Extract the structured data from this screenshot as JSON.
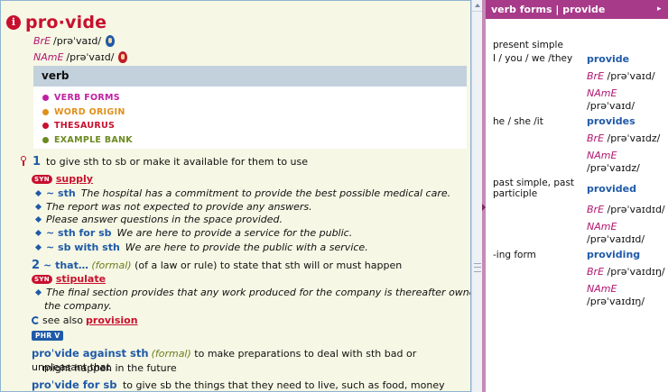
{
  "entry": {
    "headword": "pro·vide",
    "pron_bre_label": "BrE",
    "pron_bre": "/prəˈvaɪd/",
    "pron_name_label": "NAmE",
    "pron_name": "/prəˈvaɪd/",
    "pos": "verb",
    "links": [
      {
        "label": "VERB FORMS",
        "color": "#c020a0"
      },
      {
        "label": "WORD ORIGIN",
        "color": "#e0901a"
      },
      {
        "label": "THESAURUS",
        "color": "#c8102e"
      },
      {
        "label": "EXAMPLE BANK",
        "color": "#6b8a1f"
      }
    ],
    "sense1": {
      "num": "1",
      "definition": "to give sth to sb or make it available for them to use",
      "syn_badge": "SYN",
      "syn": "supply",
      "examples": [
        {
          "pattern": "~ sth",
          "text": "The hospital has a commitment to provide the best possible medical care."
        },
        {
          "pattern": "",
          "text": "The report was not expected to provide any answers."
        },
        {
          "pattern": "",
          "text": "Please answer questions in the space provided."
        },
        {
          "pattern": "~ sth for sb",
          "text": "We are here to provide a service for the public."
        },
        {
          "pattern": "~ sb with sth",
          "text": "We are here to provide the public with a service."
        }
      ]
    },
    "sense2": {
      "num": "2",
      "pattern": "~ that…",
      "register": "(formal)",
      "definition": "(of a law or rule) to state that sth will or must happen",
      "syn_badge": "SYN",
      "syn": "stipulate",
      "example_line1": "The final section provides that any work produced for the company is thereafter owned by",
      "example_line2": "the company.",
      "see_also_label": "see also",
      "see_also_link": "provision"
    },
    "phrv_badge": "PHR V",
    "phrasal": [
      {
        "head": "proˈvide against sth",
        "register": "(formal)",
        "line1": "to make preparations to deal with sth bad or unpleasant that",
        "line2": "might happen in the future"
      },
      {
        "head": "proˈvide for sb",
        "register": "",
        "line1": "to give sb the things that they need to live, such as food, money and clothing",
        "line2": ""
      }
    ]
  },
  "verb_forms": {
    "title": "verb forms | provide",
    "collapse_icon": "▸",
    "rows": [
      {
        "label": "present simple",
        "sublabel": "I / you / we /they",
        "form": "provide",
        "bre_label": "BrE",
        "bre": "/prəˈvaɪd/",
        "name_label": "NAmE",
        "name": "/prəˈvaɪd/"
      },
      {
        "label": "he / she /it",
        "sublabel": "",
        "form": "provides",
        "bre_label": "BrE",
        "bre": "/prəˈvaɪdz/",
        "name_label": "NAmE",
        "name": "/prəˈvaɪdz/"
      },
      {
        "label": "past simple, past",
        "sublabel": "participle",
        "form": "provided",
        "bre_label": "BrE",
        "bre": "/prəˈvaɪdɪd/",
        "name_label": "NAmE",
        "name": "/prəˈvaɪdɪd/"
      },
      {
        "label": "-ing form",
        "sublabel": "",
        "form": "providing",
        "bre_label": "BrE",
        "bre": "/prəˈvaɪdɪŋ/",
        "name_label": "NAmE",
        "name": "/prəˈvaɪdɪŋ/"
      }
    ]
  }
}
